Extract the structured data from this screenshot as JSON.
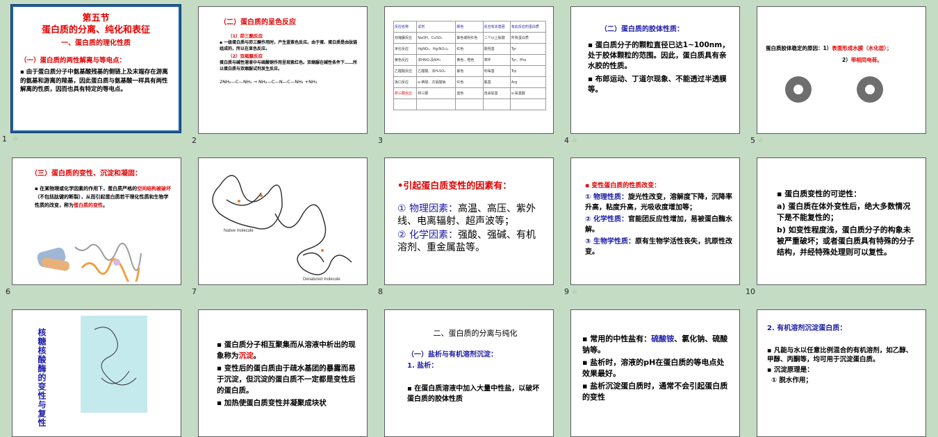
{
  "slides": [
    {
      "number": "1",
      "star": "☆",
      "title": "第五节",
      "subtitle": "蛋白质的分离、纯化和表征",
      "section": "一、蛋白质的理化性质",
      "heading": "（一）蛋白质的两性解离与等电点：",
      "body": "▪ 由于蛋白质分子中氨基酸残基的侧链上及末端存在游离的氨基和游离的羧基，因此蛋白质与氨基酸一样具有两性解离的性质，因而也具有特定的等电点。"
    },
    {
      "number": "2",
      "star": "",
      "title": "（二）蛋白质的呈色反应",
      "sub1": "（1）茚三酮反应",
      "text1": "▪ 一级蛋白质与茚三酮作用时，产生蓝紫色反应。由于蛋、蛋白质是由肽链组成的，所以在显色反应。",
      "sub2": "（2）双缩脲反应",
      "text2": "蛋白质与碱性溶液中与硫酸铜作用呈现紫红色。双缩脲在碱性条件下……所以蛋白质与双缩脲试剂发生反应。",
      "formula": "2NH₂—C—NH₂ → NH₂—C—N—C—NH₂ +NH₃"
    },
    {
      "number": "3",
      "star": "",
      "table_rows": [
        [
          "反应名称",
          "试剂",
          "颜色",
          "反应有关基团",
          "有此反应的蛋白质"
        ],
        [
          "双缩脲反应",
          "NaOH、CuSO₄",
          "紫色或粉红色",
          "二个以上肽键",
          "所有蛋白质"
        ],
        [
          "米伦反应",
          "HgNO₃、Hg(NO₃)₂",
          "红色",
          "酚羟基",
          "Tyr"
        ],
        [
          "黄色反应",
          "浓HNO₃及NH₃",
          "黄色、橙色",
          "苯环",
          "Tyr、Phe"
        ],
        [
          "乙醛酸反应",
          "乙醛酸、浓H₂SO₄",
          "紫色",
          "吲哚基",
          "Trp"
        ],
        [
          "坂口反应",
          "α-萘酚、次氯酸钠",
          "红色",
          "胍基",
          "Arg"
        ],
        [
          "茚三酮反应",
          "茚三酮",
          "蓝色",
          "自由氨基",
          "α-氨基酸"
        ]
      ]
    },
    {
      "number": "4",
      "star": "☆",
      "title": "（二）蛋白质的胶体性质：",
      "bullet1": "▪ 蛋白质分子的颗粒直径已达1~100nm，处于胶体颗粒的范围。因此，蛋白质具有亲水胶的性质。",
      "bullet2": "▪ 布郎运动、丁道尔现象、不能透过半透膜等。"
    },
    {
      "number": "5",
      "star": "☆",
      "line1a": "蛋白质胶体稳定的原因：1）",
      "line1b": "表面形成水膜（水化层）；",
      "line2a": "2）",
      "line2b": "带相同电荷。"
    },
    {
      "number": "6",
      "star": "",
      "title": "（三）蛋白质的变性、沉淀和凝固：",
      "body_a": "▪ 在某物理或化学因素的作用下，蛋白质严格的",
      "body_b": "空间结构被破坏",
      "body_c": "（不包括肽键的断裂），从而引起蛋白质若干理化性质和生物学性质的改变，称为",
      "body_d": "蛋白质的变性",
      "body_e": "。"
    },
    {
      "number": "7",
      "star": "",
      "native_label": "Native molecule",
      "unfolded_label": "Denatured molecule"
    },
    {
      "number": "8",
      "star": "",
      "heading": "•引起蛋白质变性的因素有：",
      "p1_label": "① 物理因素：",
      "p1_text": "高温、高压、紫外线、电离辐射、超声波等；",
      "p2_label": "② 化学因素：",
      "p2_text": "强酸、强碱、有机溶剂、重金属盐等。"
    },
    {
      "number": "9",
      "star": "☆",
      "heading": "▪ 变性蛋白质的性质改变：",
      "i1_label": "① 物理性质：",
      "i1_text": "旋光性改变，溶解度下降，沉降率升高，粘度升高，光吸收度增加等；",
      "i2_label": "② 化学性质：",
      "i2_text": "官能团反应性增加，易被蛋白酶水解。",
      "i3_label": "③ 生物学性质：",
      "i3_text": "原有生物学活性丧失，抗原性改变。"
    },
    {
      "number": "10",
      "star": "",
      "heading": "▪ 蛋白质变性的可逆性：",
      "a": "a) 蛋白质在体外变性后，绝大多数情况下是不能复性的；",
      "b": "b) 如变性程度浅，蛋白质分子的构象未被严重破坏；或者蛋白质具有特殊的分子结构，并经特殊处理则可以复性。"
    },
    {
      "number": "",
      "star": "",
      "vertical": "核糖核酸酶的变性与复性"
    },
    {
      "number": "",
      "star": "",
      "b1a": "▪ 蛋白质分子相互聚集而从溶液中析出的现象称为",
      "b1b": "沉淀",
      "b1c": "。",
      "b2": "▪ 变性后的蛋白质由于疏水基团的暴露而易于沉淀，但沉淀的蛋白质不一定都是变性后的蛋白质。",
      "b3": "▪ 加热使蛋白质变性并凝聚成块状"
    },
    {
      "number": "",
      "star": "",
      "section": "二、蛋白质的分离与纯化",
      "heading": "（一）盐析与有机溶剂沉淀：",
      "sub": "1. 盐析：",
      "body": "▪ 在蛋白质溶液中加入大量中性盐，以破坏蛋白质的胶体性质"
    },
    {
      "number": "",
      "star": "",
      "b1a": "▪ 常用的中性盐有：",
      "b1b": "硫酸铵",
      "b1c": "、氯化钠、硫酸钠等。",
      "b2": "▪ 盐析时，溶液的pH在蛋白质的等电点处效果最好。",
      "b3": "▪ 盐析沉淀蛋白质时，通常不会引起蛋白质的变性"
    },
    {
      "number": "",
      "star": "",
      "heading": "2. 有机溶剂沉淀蛋白质：",
      "b1": "▪ 凡能与水以任意比例混合的有机溶剂，如乙醇、甲醇、丙酮等，均可用于沉淀蛋白质。",
      "b2": "▪ 沉淀原理是：",
      "b3": "① 脱水作用；"
    }
  ]
}
